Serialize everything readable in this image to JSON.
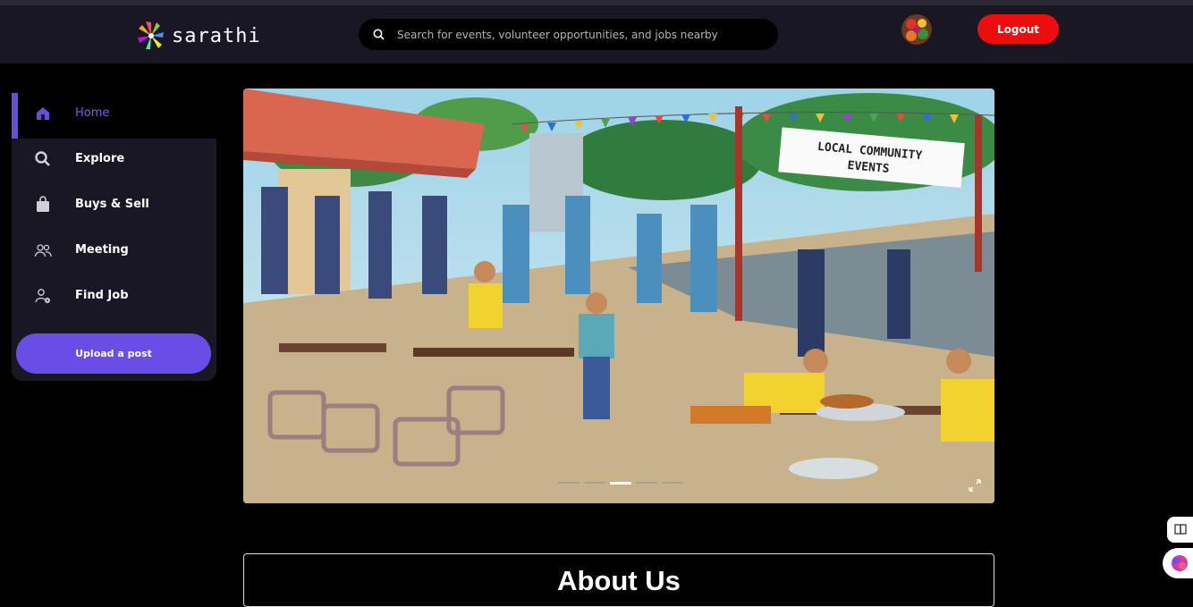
{
  "header": {
    "logo_text": "sarathi",
    "search_placeholder": "Search for events, volunteer opportunities, and jobs nearby",
    "logout_label": "Logout"
  },
  "sidebar": {
    "items": [
      {
        "label": "Home",
        "icon": "home-icon",
        "active": true
      },
      {
        "label": "Explore",
        "icon": "search-icon"
      },
      {
        "label": "Buys & Sell",
        "icon": "shopping-bag-icon"
      },
      {
        "label": "Meeting",
        "icon": "users-icon"
      },
      {
        "label": "Find Job",
        "icon": "user-gear-icon"
      }
    ],
    "upload_label": "Upload a post"
  },
  "carousel": {
    "banner_text": "LOCAL COMMUNITY EVENTS",
    "slide_count": 5,
    "active_slide": 3
  },
  "about": {
    "title": "About Us"
  },
  "colors": {
    "accent": "#6a4ce6",
    "logout": "#ee0d0d",
    "panel": "#1a1725"
  }
}
